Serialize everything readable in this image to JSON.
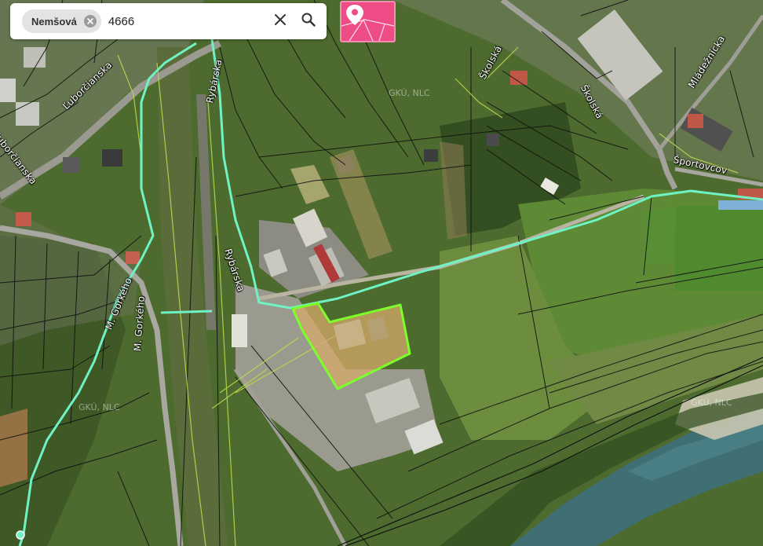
{
  "search": {
    "chip_label": "Nemšová",
    "value": "4666"
  },
  "icons": {
    "chip_remove": "close-circle-icon",
    "clear": "close-icon",
    "search": "search-icon",
    "locate": "map-pin-icon"
  },
  "colors": {
    "accent": "#ee4c86",
    "parcel_highlight": "#7cff2a",
    "cadastre_boundary": "#6ff3c4"
  },
  "map": {
    "streets": [
      "Ľuborčianska",
      "Ľuborčianska",
      "Rybárska",
      "Rybárska",
      "M. Gorkého",
      "M. Gorkého",
      "Školská",
      "Školská",
      "Mládežnícka",
      "Športovcov"
    ],
    "watermarks": [
      "GKÚ, NLC",
      "GKÚ, NLC",
      "GKÚ, NLC"
    ]
  }
}
